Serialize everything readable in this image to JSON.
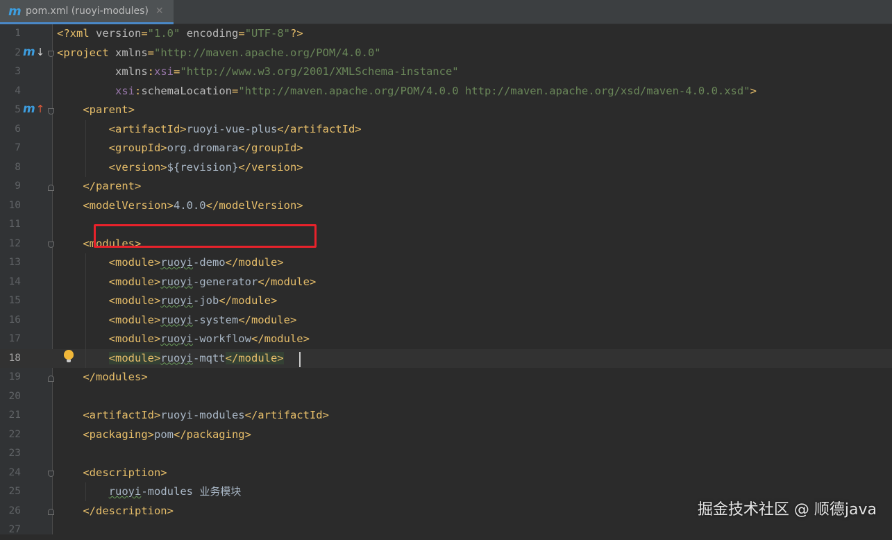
{
  "tab": {
    "icon": "maven-icon",
    "icon_glyph": "m",
    "title": "pom.xml (ruoyi-modules)",
    "close_glyph": "✕"
  },
  "gutter_icons": {
    "line2": {
      "glyph": "m",
      "arrow": "↓",
      "name": "maven-implementing-icon"
    },
    "line5": {
      "glyph": "m",
      "arrow": "↑",
      "name": "maven-overrides-icon"
    }
  },
  "lines": [
    {
      "n": "1",
      "tokens": [
        [
          "tag",
          "<?xml "
        ],
        [
          "attr",
          "version"
        ],
        [
          "tag",
          "="
        ],
        [
          "val",
          "\"1.0\""
        ],
        [
          "tag",
          " "
        ],
        [
          "attr",
          "encoding"
        ],
        [
          "tag",
          "="
        ],
        [
          "val",
          "\"UTF-8\""
        ],
        [
          "tag",
          "?>"
        ]
      ]
    },
    {
      "n": "2",
      "tokens": [
        [
          "tag",
          "<project "
        ],
        [
          "attr",
          "xmlns"
        ],
        [
          "tag",
          "="
        ],
        [
          "val",
          "\"http://maven.apache.org/POM/4.0.0\""
        ]
      ]
    },
    {
      "n": "3",
      "tokens": [
        [
          "text",
          "         "
        ],
        [
          "attr",
          "xmlns"
        ],
        [
          "tag",
          ":"
        ],
        [
          "ns",
          "xsi"
        ],
        [
          "tag",
          "="
        ],
        [
          "val",
          "\"http://www.w3.org/2001/XMLSchema-instance\""
        ]
      ]
    },
    {
      "n": "4",
      "tokens": [
        [
          "text",
          "         "
        ],
        [
          "ns",
          "xsi"
        ],
        [
          "tag",
          ":"
        ],
        [
          "attr",
          "schemaLocation"
        ],
        [
          "tag",
          "="
        ],
        [
          "val",
          "\"http://maven.apache.org/POM/4.0.0 http://maven.apache.org/xsd/maven-4.0.0.xsd\""
        ],
        [
          "tag",
          ">"
        ]
      ]
    },
    {
      "n": "5",
      "tokens": [
        [
          "text",
          "    "
        ],
        [
          "tag",
          "<parent>"
        ]
      ]
    },
    {
      "n": "6",
      "tokens": [
        [
          "text",
          "        "
        ],
        [
          "tag",
          "<artifactId>"
        ],
        [
          "text",
          "ruoyi-vue-plus"
        ],
        [
          "tag",
          "</artifactId>"
        ]
      ]
    },
    {
      "n": "7",
      "tokens": [
        [
          "text",
          "        "
        ],
        [
          "tag",
          "<groupId>"
        ],
        [
          "text",
          "org.dromara"
        ],
        [
          "tag",
          "</groupId>"
        ]
      ]
    },
    {
      "n": "8",
      "tokens": [
        [
          "text",
          "        "
        ],
        [
          "tag",
          "<version>"
        ],
        [
          "text",
          "${revision}"
        ],
        [
          "tag",
          "</version>"
        ]
      ]
    },
    {
      "n": "9",
      "tokens": [
        [
          "text",
          "    "
        ],
        [
          "tag",
          "</parent>"
        ]
      ]
    },
    {
      "n": "10",
      "tokens": [
        [
          "text",
          "    "
        ],
        [
          "tag",
          "<modelVersion>"
        ],
        [
          "text",
          "4.0.0"
        ],
        [
          "tag",
          "</modelVersion>"
        ]
      ]
    },
    {
      "n": "11",
      "tokens": []
    },
    {
      "n": "12",
      "tokens": [
        [
          "text",
          "    "
        ],
        [
          "tag",
          "<modules>"
        ]
      ]
    },
    {
      "n": "13",
      "tokens": [
        [
          "text",
          "        "
        ],
        [
          "tag",
          "<module>"
        ],
        [
          "squig",
          "ruoyi"
        ],
        [
          "text",
          "-demo"
        ],
        [
          "tag",
          "</module>"
        ]
      ]
    },
    {
      "n": "14",
      "tokens": [
        [
          "text",
          "        "
        ],
        [
          "tag",
          "<module>"
        ],
        [
          "squig",
          "ruoyi"
        ],
        [
          "text",
          "-generator"
        ],
        [
          "tag",
          "</module>"
        ]
      ]
    },
    {
      "n": "15",
      "tokens": [
        [
          "text",
          "        "
        ],
        [
          "tag",
          "<module>"
        ],
        [
          "squig",
          "ruoyi"
        ],
        [
          "text",
          "-job"
        ],
        [
          "tag",
          "</module>"
        ]
      ]
    },
    {
      "n": "16",
      "tokens": [
        [
          "text",
          "        "
        ],
        [
          "tag",
          "<module>"
        ],
        [
          "squig",
          "ruoyi"
        ],
        [
          "text",
          "-system"
        ],
        [
          "tag",
          "</module>"
        ]
      ]
    },
    {
      "n": "17",
      "tokens": [
        [
          "text",
          "        "
        ],
        [
          "tag",
          "<module>"
        ],
        [
          "squig",
          "ruoyi"
        ],
        [
          "text",
          "-workflow"
        ],
        [
          "tag",
          "</module>"
        ]
      ]
    },
    {
      "n": "18",
      "tokens": [
        [
          "text",
          "        "
        ],
        [
          "taghl",
          "<module>"
        ],
        [
          "squig",
          "ruoyi"
        ],
        [
          "text",
          "-mqtt"
        ],
        [
          "taghl",
          "</module>"
        ]
      ]
    },
    {
      "n": "19",
      "tokens": [
        [
          "text",
          "    "
        ],
        [
          "tag",
          "</modules>"
        ]
      ]
    },
    {
      "n": "20",
      "tokens": []
    },
    {
      "n": "21",
      "tokens": [
        [
          "text",
          "    "
        ],
        [
          "tag",
          "<artifactId>"
        ],
        [
          "text",
          "ruoyi-modules"
        ],
        [
          "tag",
          "</artifactId>"
        ]
      ]
    },
    {
      "n": "22",
      "tokens": [
        [
          "text",
          "    "
        ],
        [
          "tag",
          "<packaging>"
        ],
        [
          "text",
          "pom"
        ],
        [
          "tag",
          "</packaging>"
        ]
      ]
    },
    {
      "n": "23",
      "tokens": []
    },
    {
      "n": "24",
      "tokens": [
        [
          "text",
          "    "
        ],
        [
          "tag",
          "<description>"
        ]
      ]
    },
    {
      "n": "25",
      "tokens": [
        [
          "text",
          "        "
        ],
        [
          "squig",
          "ruoyi"
        ],
        [
          "text",
          "-modules "
        ],
        [
          "cjk",
          "业务模块"
        ]
      ]
    },
    {
      "n": "26",
      "tokens": [
        [
          "text",
          "    "
        ],
        [
          "tag",
          "</description>"
        ]
      ]
    },
    {
      "n": "27",
      "tokens": []
    }
  ],
  "caret_line": "18",
  "watermark": "掘金技术社区 @ 顺德java",
  "colors": {
    "background": "#2b2b2b",
    "tag": "#e8bf6a",
    "attribute": "#bababa",
    "namespace": "#9876aa",
    "value": "#6a8759",
    "text": "#a9b7c6",
    "highlight_box": "#e8222b",
    "accent": "#4a88c7"
  }
}
